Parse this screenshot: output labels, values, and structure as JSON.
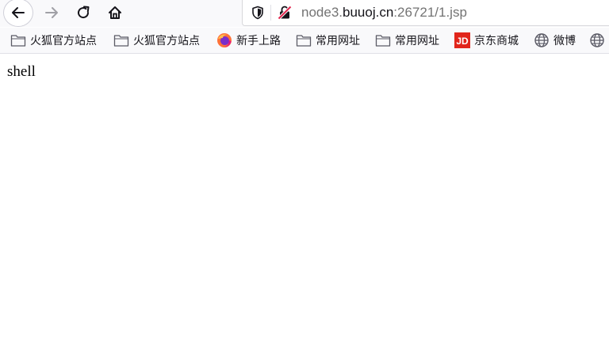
{
  "urlbar": {
    "url_prefix": "node3.",
    "url_host": "buuoj.cn",
    "url_suffix": ":26721/1.jsp"
  },
  "bookmarks": [
    {
      "label": "火狐官方站点",
      "icon": "folder-icon"
    },
    {
      "label": "火狐官方站点",
      "icon": "folder-icon"
    },
    {
      "label": "新手上路",
      "icon": "firefox-icon"
    },
    {
      "label": "常用网址",
      "icon": "folder-icon"
    },
    {
      "label": "常用网址",
      "icon": "folder-icon"
    },
    {
      "label": "京东商城",
      "icon": "jd-icon"
    },
    {
      "label": "微博",
      "icon": "globe-icon"
    }
  ],
  "jd_icon_text": "JD",
  "page": {
    "body_text": "shell"
  },
  "colors": {
    "toolbar_bg": "#f9f9fb",
    "jd_red": "#e1251b",
    "insecure_red": "#e22850"
  }
}
